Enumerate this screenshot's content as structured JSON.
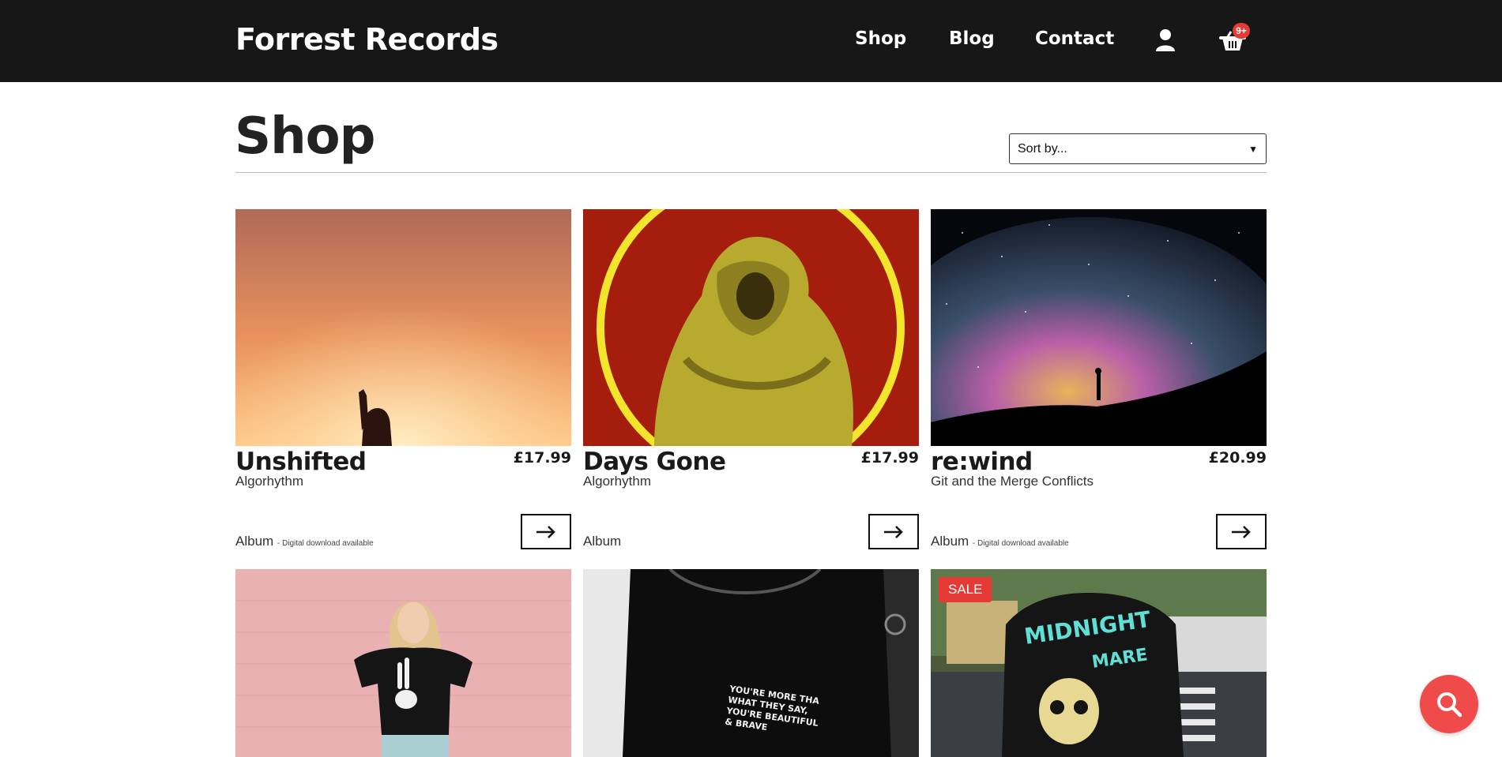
{
  "header": {
    "brand": "Forrest Records",
    "nav": {
      "shop": "Shop",
      "blog": "Blog",
      "contact": "Contact"
    },
    "cart_badge": "9+",
    "icons": [
      "user-icon",
      "basket-icon"
    ]
  },
  "page": {
    "title": "Shop",
    "sort": {
      "selected": "Sort by..."
    }
  },
  "products": [
    {
      "title": "Unshifted",
      "price": "£17.99",
      "artist": "Algorhythm",
      "format": "Album",
      "note": "- Digital download available"
    },
    {
      "title": "Days Gone",
      "price": "£17.99",
      "artist": "Algorhythm",
      "format": "Album",
      "note": ""
    },
    {
      "title": "re:wind",
      "price": "£20.99",
      "artist": "Git and the Merge Conflicts",
      "format": "Album",
      "note": "- Digital download available"
    },
    {
      "title": "",
      "price": "",
      "artist": "",
      "format": "",
      "note": "",
      "badge": ""
    },
    {
      "title": "",
      "price": "",
      "artist": "",
      "format": "",
      "note": "",
      "badge": "",
      "shirt_text": "YOU'RE MORE THA WHAT THEY SAY, YOU'RE BEAUTIFUL & BRAVE"
    },
    {
      "title": "",
      "price": "",
      "artist": "",
      "format": "",
      "note": "",
      "badge": "SALE",
      "shirt_text": "MIDNIGHT MARE"
    }
  ],
  "search_fab": {
    "icon": "search-icon"
  },
  "colors": {
    "header_bg": "#171717",
    "accent": "#ef4b4b",
    "badge": "#e53935"
  }
}
